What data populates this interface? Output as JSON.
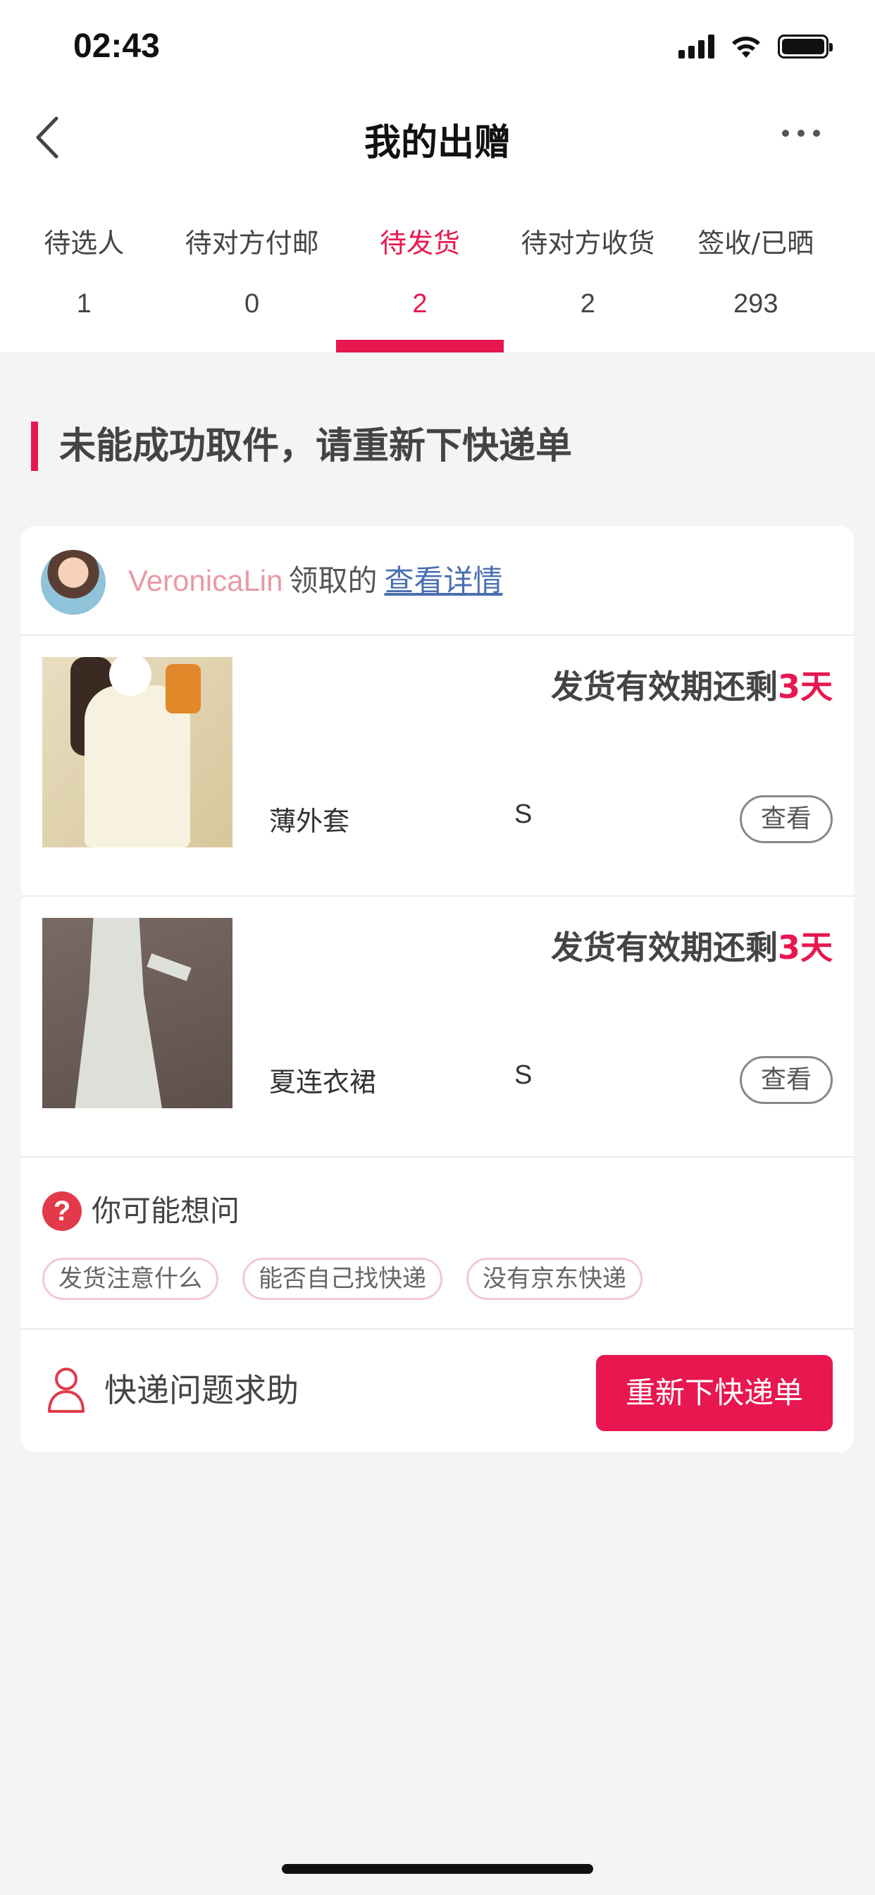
{
  "status_bar": {
    "time": "02:43"
  },
  "nav": {
    "title": "我的出赠"
  },
  "tabs": [
    {
      "label": "待选人",
      "count": "1",
      "active": false
    },
    {
      "label": "待对方付邮",
      "count": "0",
      "active": false
    },
    {
      "label": "待发货",
      "count": "2",
      "active": true
    },
    {
      "label": "待对方收货",
      "count": "2",
      "active": false
    },
    {
      "label": "签收/已晒",
      "count": "293",
      "active": false
    }
  ],
  "section": {
    "title": "未能成功取件，请重新下快递单"
  },
  "receiver": {
    "name": "VeronicaLin",
    "verb": "领取的",
    "link": "查看详情"
  },
  "items": [
    {
      "deadline_prefix": "发货有效期还剩",
      "deadline_days": "3天",
      "name": "薄外套",
      "size": "S",
      "view_label": "查看"
    },
    {
      "deadline_prefix": "发货有效期还剩",
      "deadline_days": "3天",
      "name": "夏连衣裙",
      "size": "S",
      "view_label": "查看"
    }
  ],
  "faq": {
    "icon_text": "?",
    "title": "你可能想问",
    "chips": [
      "发货注意什么",
      "能否自己找快递",
      "没有京东快递"
    ]
  },
  "help": {
    "label": "快递问题求助",
    "button": "重新下快递单"
  },
  "colors": {
    "accent": "#e8174f",
    "link": "#4a6fb0",
    "receiver_name": "#e89aa4"
  }
}
